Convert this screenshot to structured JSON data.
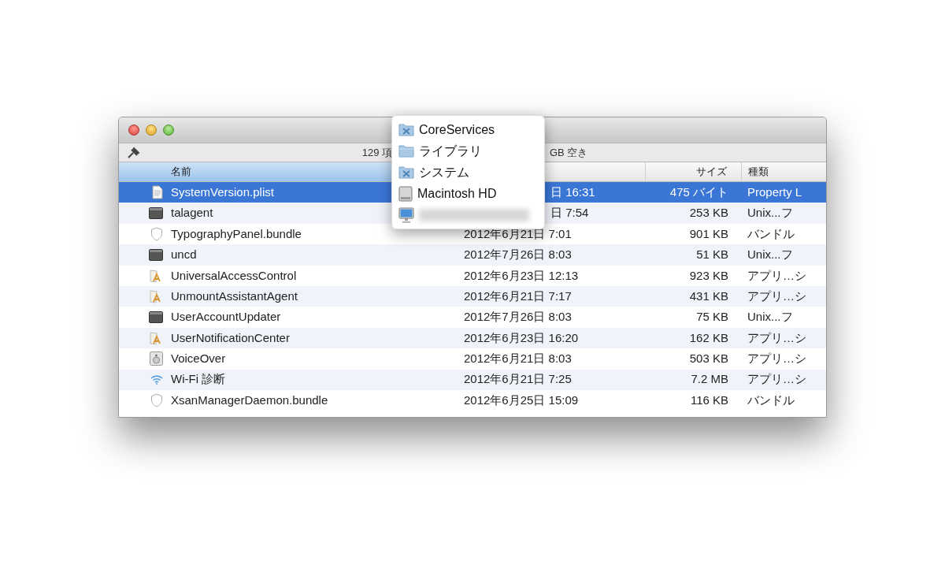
{
  "status_bar": {
    "left": "129 項",
    "right": "GB 空き"
  },
  "columns": [
    {
      "label": "名前",
      "sorted": true
    },
    {
      "sorted": false
    },
    {
      "label": "サイズ",
      "sorted": false
    },
    {
      "label": "種類",
      "sorted": false
    }
  ],
  "rows": [
    {
      "kind": "document",
      "name": "SystemVersion.plist",
      "date": "日 16:31",
      "size": "475 バイト",
      "type": "Property L",
      "selected": true,
      "covered": true
    },
    {
      "kind": "executable",
      "name": "talagent",
      "date": "日 7:54",
      "size": "253 KB",
      "type": "Unix...フ",
      "selected": false,
      "covered": true
    },
    {
      "kind": "bundle",
      "name": "TypographyPanel.bundle",
      "date": "2012年6月21日 7:01",
      "size": "901 KB",
      "type": "バンドル",
      "selected": false,
      "covered": false
    },
    {
      "kind": "executable",
      "name": "uncd",
      "date": "2012年7月26日 8:03",
      "size": "51 KB",
      "type": "Unix...フ",
      "selected": false,
      "covered": false
    },
    {
      "kind": "application",
      "name": "UniversalAccessControl",
      "date": "2012年6月23日 12:13",
      "size": "923 KB",
      "type": "アプリ…シ",
      "selected": false,
      "covered": false
    },
    {
      "kind": "application",
      "name": "UnmountAssistantAgent",
      "date": "2012年6月21日 7:17",
      "size": "431 KB",
      "type": "アプリ…シ",
      "selected": false,
      "covered": false
    },
    {
      "kind": "executable",
      "name": "UserAccountUpdater",
      "date": "2012年7月26日 8:03",
      "size": "75 KB",
      "type": "Unix...フ",
      "selected": false,
      "covered": false
    },
    {
      "kind": "application",
      "name": "UserNotificationCenter",
      "date": "2012年6月23日 16:20",
      "size": "162 KB",
      "type": "アプリ…シ",
      "selected": false,
      "covered": false
    },
    {
      "kind": "utility",
      "name": "VoiceOver",
      "date": "2012年6月21日 8:03",
      "size": "503 KB",
      "type": "アプリ…シ",
      "selected": false,
      "covered": false
    },
    {
      "kind": "wifi",
      "name": "Wi-Fi 診断",
      "date": "2012年6月21日 7:25",
      "size": "7.2 MB",
      "type": "アプリ…シ",
      "selected": false,
      "covered": false
    },
    {
      "kind": "bundle",
      "name": "XsanManagerDaemon.bundle",
      "date": "2012年6月25日 15:09",
      "size": "116 KB",
      "type": "バンドル",
      "selected": false,
      "covered": false
    }
  ],
  "path_menu": [
    {
      "kind": "system-folder",
      "label": "CoreServices"
    },
    {
      "kind": "folder",
      "label": "ライブラリ"
    },
    {
      "kind": "system-folder",
      "label": "システム"
    },
    {
      "kind": "drive",
      "label": "Macintosh HD"
    },
    {
      "kind": "computer",
      "blurred": true
    }
  ]
}
